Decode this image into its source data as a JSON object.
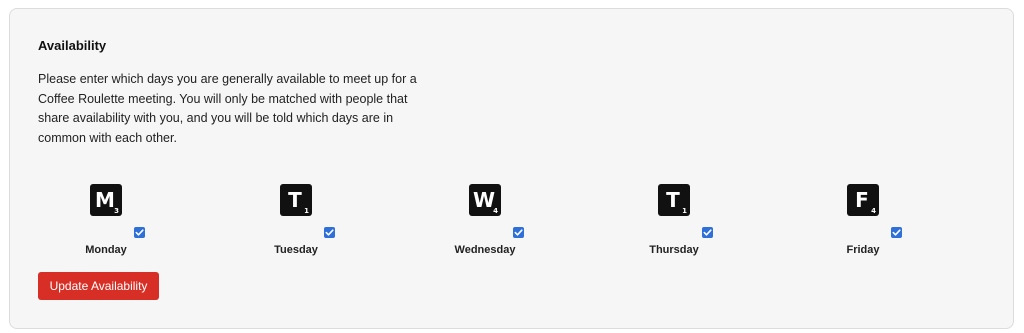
{
  "availability": {
    "title": "Availability",
    "description": "Please enter which days you are generally available to meet up for a Coffee Roulette meeting. You will only be matched with people that share availability with you, and you will be told which days are in common with each other.",
    "days": [
      {
        "label": "Monday",
        "tile_letter": "M",
        "tile_score": "3",
        "checked": true
      },
      {
        "label": "Tuesday",
        "tile_letter": "T",
        "tile_score": "1",
        "checked": true
      },
      {
        "label": "Wednesday",
        "tile_letter": "W",
        "tile_score": "4",
        "checked": true
      },
      {
        "label": "Thursday",
        "tile_letter": "T",
        "tile_score": "1",
        "checked": true
      },
      {
        "label": "Friday",
        "tile_letter": "F",
        "tile_score": "4",
        "checked": true
      }
    ],
    "update_button_label": "Update Availability"
  },
  "colors": {
    "button_background": "#d72f25",
    "checkbox_accent": "#2e6fd8",
    "tile_background": "#111111",
    "card_background": "#f6f6f6"
  }
}
